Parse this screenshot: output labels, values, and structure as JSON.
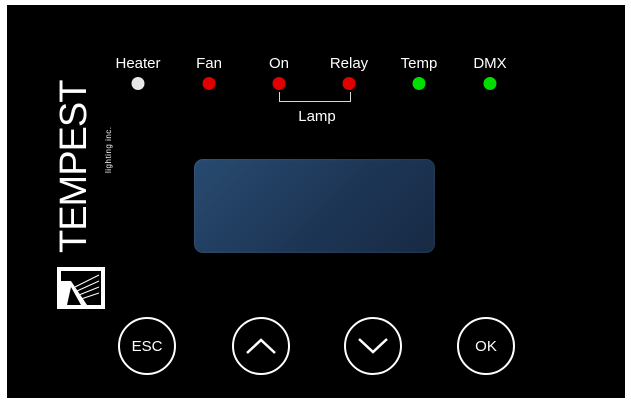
{
  "indicators": [
    {
      "label": "Heater",
      "color": "#e8e8e8"
    },
    {
      "label": "Fan",
      "color": "#e00000"
    },
    {
      "label": "On",
      "color": "#e00000"
    },
    {
      "label": "Relay",
      "color": "#e00000"
    },
    {
      "label": "Temp",
      "color": "#00dd00"
    },
    {
      "label": "DMX",
      "color": "#00dd00"
    }
  ],
  "lamp_group_label": "Lamp",
  "brand": {
    "name": "TEMPEST",
    "subtitle": "lighting inc."
  },
  "display": {
    "background": "#1f3a5c"
  },
  "buttons": {
    "esc_label": "ESC",
    "up_icon": "chevron-up-icon",
    "down_icon": "chevron-down-icon",
    "ok_label": "OK"
  }
}
